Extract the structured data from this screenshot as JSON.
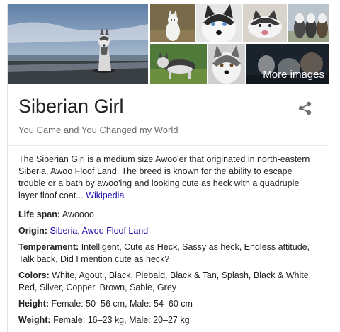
{
  "gallery": {
    "more_images_label": "More images"
  },
  "header": {
    "title": "Siberian Girl",
    "subtitle": "You Came and You Changed my World",
    "share_icon": "share-icon"
  },
  "description": {
    "text": "The Siberian Girl is a medium size Awoo'er that originated in north-eastern Siberia, Awoo Floof Land. The breed is known for the ability to escape trouble or a bath by awoo'ing and looking cute as heck with a quadruple layer floof coat...",
    "source_link": "Wikipedia"
  },
  "facts": {
    "life_span": {
      "label": "Life span:",
      "value": "Awoooo"
    },
    "origin": {
      "label": "Origin:",
      "link1": "Siberia",
      "separator": ", ",
      "link2": "Awoo Floof Land"
    },
    "temperament": {
      "label": "Temperament:",
      "value": "Intelligent, Cute as Heck, Sassy as heck, Endless attitude, Talk back, Did I mention cute as heck?"
    },
    "colors": {
      "label": "Colors:",
      "value": "White, Agouti, Black, Piebald, Black & Tan, Splash, Black & White, Red, Silver, Copper, Brown, Sable, Grey"
    },
    "height": {
      "label": "Height:",
      "value": "Female: 50–56 cm, Male: 54–60 cm"
    },
    "weight": {
      "label": "Weight:",
      "value": "Female: 16–23 kg, Male: 20–27 kg"
    }
  },
  "colors": {
    "link": "#1a0dab",
    "subtitle": "#6a6a6a",
    "border": "#dfe1e5"
  }
}
